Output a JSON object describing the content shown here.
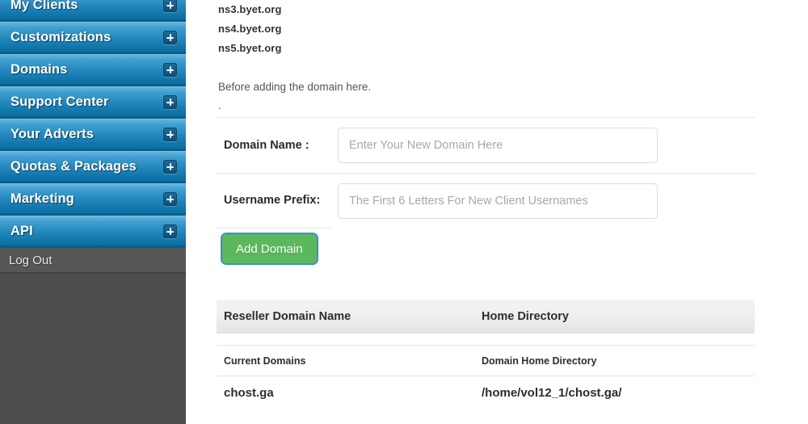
{
  "sidebar": {
    "items": [
      {
        "label": "My Clients",
        "icon": "plus-icon"
      },
      {
        "label": "Customizations",
        "icon": "plus-icon"
      },
      {
        "label": "Domains",
        "icon": "plus-icon"
      },
      {
        "label": "Support Center",
        "icon": "plus-icon"
      },
      {
        "label": "Your Adverts",
        "icon": "plus-icon"
      },
      {
        "label": "Quotas & Packages",
        "icon": "plus-icon"
      },
      {
        "label": "Marketing",
        "icon": "plus-icon"
      },
      {
        "label": "API",
        "icon": "plus-icon"
      }
    ],
    "logout_label": "Log Out",
    "colors": {
      "item_top": "#64b4dc",
      "item_bottom": "#0d6e9f",
      "panel": "#4d4d4d",
      "logout": "#565656"
    }
  },
  "main": {
    "nameservers": [
      "ns3.byet.org",
      "ns4.byet.org",
      "ns5.byet.org"
    ],
    "note": "Before adding the domain here.",
    "note_dot": ".",
    "form": {
      "domain_name_label": "Domain Name :",
      "domain_name_value": "",
      "domain_name_placeholder": "Enter Your New Domain Here",
      "username_prefix_label": "Username Prefix:",
      "username_prefix_value": "",
      "username_prefix_placeholder": "The First 6 Letters For New Client Usernames",
      "submit_label": "Add Domain",
      "submit_color": "#5cb85c"
    },
    "table": {
      "headers": [
        "Reseller Domain Name",
        "Home Directory"
      ],
      "subheader": [
        "Current Domains",
        "Domain Home Directory"
      ],
      "rows": [
        [
          "chost.ga",
          "/home/vol12_1/chost.ga/"
        ]
      ]
    }
  }
}
